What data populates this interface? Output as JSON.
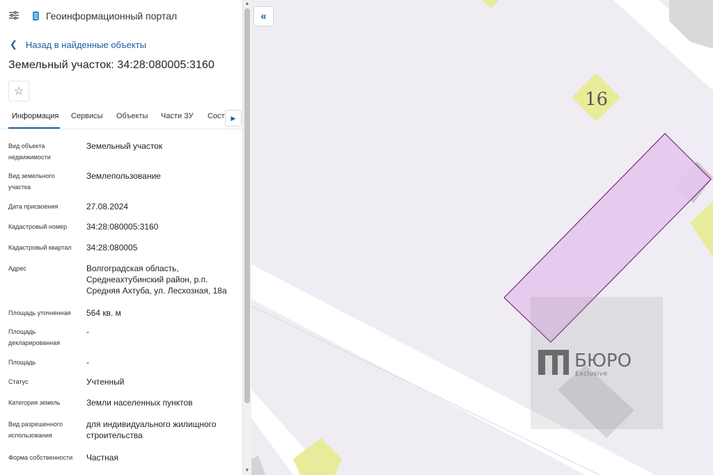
{
  "header": {
    "title": "Геоинформационный портал"
  },
  "back_link": {
    "label": "Назад в найденные объекты"
  },
  "object": {
    "title": "Земельный участок: 34:28:080005:3160"
  },
  "tabs": [
    {
      "label": "Информация",
      "active": true
    },
    {
      "label": "Сервисы"
    },
    {
      "label": "Объекты"
    },
    {
      "label": "Части ЗУ"
    },
    {
      "label": "Состав"
    }
  ],
  "properties": [
    {
      "label": "Вид объекта недвижимости",
      "value": "Земельный участок"
    },
    {
      "label": "Вид земельного участка",
      "value": "Землепользование"
    },
    {
      "label": "Дата присвоения",
      "value": "27.08.2024"
    },
    {
      "label": "Кадастровый номер",
      "value": "34:28:080005:3160"
    },
    {
      "label": "Кадастровый квартал",
      "value": "34:28:080005"
    },
    {
      "label": "Адрес",
      "value": "Волгоградская область, Среднеахтубинский район, р.п. Средняя Ахтуба, ул. Лесхозная, 18а"
    },
    {
      "label": "Площадь уточненная",
      "value": "564 кв. м"
    },
    {
      "label": "Площадь декларированная",
      "value": "-"
    },
    {
      "label": "Площадь",
      "value": "-"
    },
    {
      "label": "Статус",
      "value": "Учтенный"
    },
    {
      "label": "Категория земель",
      "value": "Земли населенных пунктов"
    },
    {
      "label": "Вид разрешенного использования",
      "value": "для индивидуального жилищного строительства"
    },
    {
      "label": "Форма собственности",
      "value": "Частная"
    }
  ],
  "map": {
    "house_number": "16",
    "watermark_title": "БЮРО",
    "watermark_subtitle": "Exclusive",
    "colors": {
      "parcel_fill": "#e4c6ee",
      "parcel_stroke": "#7a2a7a",
      "building": "#e8ec9a",
      "road": "#ffffff",
      "background": "#efedf3"
    }
  },
  "icons": {
    "menu": "sliders-menu-icon",
    "logo": "portal-logo-icon",
    "back": "chevron-left-icon",
    "favorite": "star-outline-icon",
    "tab_next": "chevron-right-icon",
    "collapse": "double-chevron-left-icon"
  }
}
